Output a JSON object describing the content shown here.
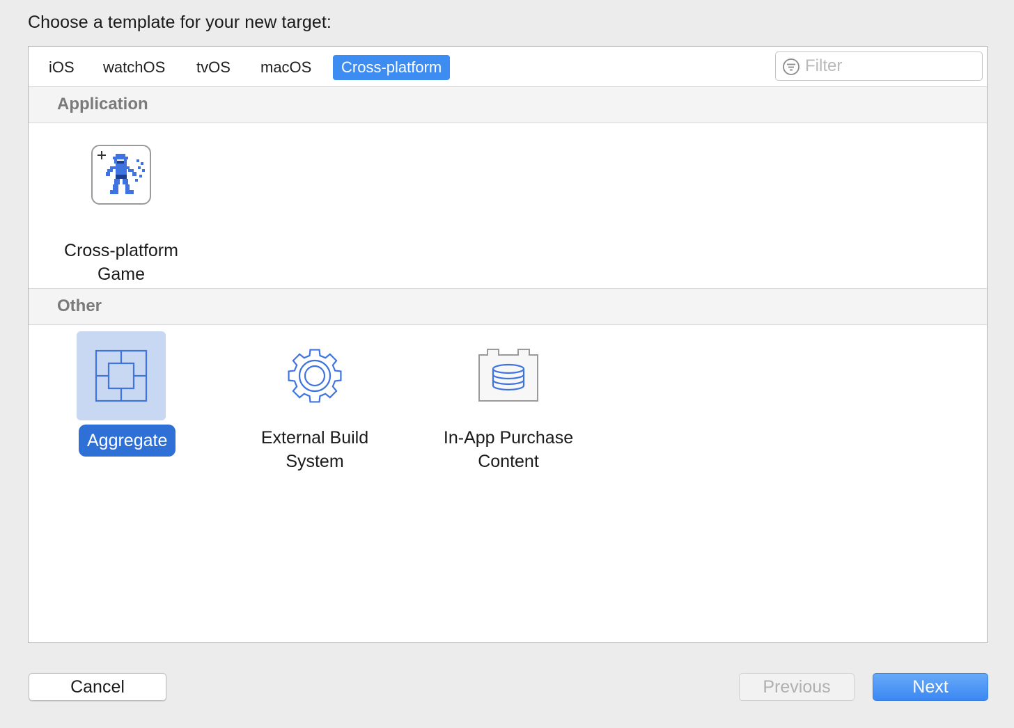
{
  "dialog": {
    "prompt": "Choose a template for your new target:"
  },
  "tabs": [
    {
      "label": "iOS",
      "active": false
    },
    {
      "label": "watchOS",
      "active": false
    },
    {
      "label": "tvOS",
      "active": false
    },
    {
      "label": "macOS",
      "active": false
    },
    {
      "label": "Cross-platform",
      "active": true
    }
  ],
  "filter": {
    "placeholder": "Filter"
  },
  "sections": [
    {
      "title": "Application",
      "templates": [
        {
          "line1": "Cross-platform",
          "line2": "Game",
          "icon": "game-sprite-icon",
          "selected": false
        }
      ]
    },
    {
      "title": "Other",
      "templates": [
        {
          "line1": "Aggregate",
          "line2": "",
          "icon": "aggregate-icon",
          "selected": true
        },
        {
          "line1": "External Build",
          "line2": "System",
          "icon": "gear-icon",
          "selected": false
        },
        {
          "line1": "In-App Purchase",
          "line2": "Content",
          "icon": "in-app-purchase-icon",
          "selected": false
        }
      ]
    }
  ],
  "buttons": {
    "cancel": "Cancel",
    "previous": "Previous",
    "next": "Next"
  },
  "colors": {
    "accent": "#3d8cf1",
    "selection_bg": "#c9d8f2",
    "selection_label": "#2f70d6",
    "icon_blue": "#3f74e0"
  }
}
